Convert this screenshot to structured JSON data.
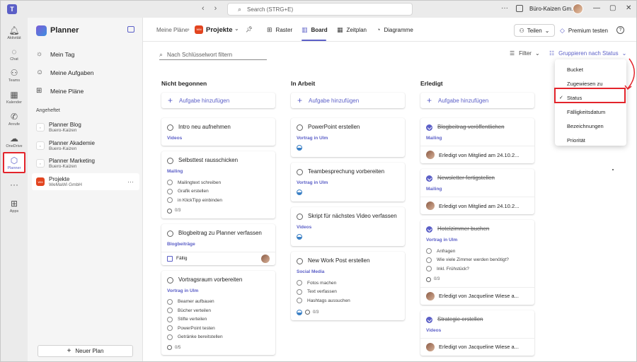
{
  "titlebar": {
    "search_placeholder": "Search (STRG+E)",
    "org_name": "Büro-Kaizen Gm..."
  },
  "rail": [
    {
      "label": "Aktivität",
      "icon": "bell-icon"
    },
    {
      "label": "Chat",
      "icon": "chat-icon"
    },
    {
      "label": "Teams",
      "icon": "teams-icon"
    },
    {
      "label": "Kalender",
      "icon": "calendar-icon"
    },
    {
      "label": "Anrufe",
      "icon": "phone-icon"
    },
    {
      "label": "OneDrive",
      "icon": "cloud-icon"
    },
    {
      "label": "Planner",
      "icon": "planner-icon"
    },
    {
      "label": "Apps",
      "icon": "apps-icon"
    }
  ],
  "sidebar": {
    "title": "Planner",
    "nav": [
      "Mein Tag",
      "Meine Aufgaben",
      "Meine Pläne"
    ],
    "pinned_heading": "Angeheftet",
    "plans": [
      {
        "name": "Planner Blog",
        "sub": "Buero-Kaizen"
      },
      {
        "name": "Planner Akademie",
        "sub": "Buero-Kaizen"
      },
      {
        "name": "Planner Marketing",
        "sub": "Buero-Kaizen"
      },
      {
        "name": "Projekte",
        "sub": "WeMaWi GmbH"
      }
    ],
    "new_plan": "Neuer Plan"
  },
  "header": {
    "breadcrumb": "Meine Pläne",
    "plan_name": "Projekte",
    "tabs": [
      "Raster",
      "Board",
      "Zeitplan",
      "Diagramme"
    ],
    "share": "Teilen",
    "premium": "Premium testen"
  },
  "filterbar": {
    "keyword_placeholder": "Nach Schlüsselwort filtern",
    "filter": "Filter",
    "group_by": "Gruppieren nach Status"
  },
  "add_task_label": "Aufgabe hinzufügen",
  "columns": [
    {
      "title": "Nicht begonnen",
      "cards": [
        {
          "title": "Intro neu aufnehmen",
          "label": "Videos"
        },
        {
          "title": "Selbsttest rausschicken",
          "label": "Mailing",
          "checklist": [
            "Mailingtext schreiben",
            "Grafik erstellen",
            "in KlickTipp einbinden"
          ],
          "count": "0/3"
        },
        {
          "title": "Blogbeitrag zu Planner verfassen",
          "label": "Blogbeiträge",
          "due": "Fällig"
        },
        {
          "title": "Vortragsraum vorbereiten",
          "label": "Vortrag in Ulm",
          "checklist": [
            "Beamer aufbauen",
            "Bücher verteilen",
            "Stifte verteilen",
            "PowerPoint testen",
            "Getränke bereitstellen"
          ],
          "count": "0/5"
        }
      ]
    },
    {
      "title": "In Arbeit",
      "cards": [
        {
          "title": "PowerPoint erstellen",
          "label": "Vortrag in Ulm"
        },
        {
          "title": "Teambesprechung vorbereiten",
          "label": "Vortrag in Ulm"
        },
        {
          "title": "Skript für nächstes Video verfassen",
          "label": "Videos"
        },
        {
          "title": "New Work Post erstellen",
          "label": "Social Media",
          "checklist": [
            "Fotos machen",
            "Text verfassen",
            "Hashtags aussuchen"
          ],
          "count": "0/3"
        }
      ]
    },
    {
      "title": "Erledigt",
      "cards": [
        {
          "title": "Blogbeitrag veröffentlichen",
          "label": "Mailing",
          "footer": "Erledigt von Mitglied am 24.10.2..."
        },
        {
          "title": "Newsletter fertigstellen",
          "label": "Mailing",
          "footer": "Erledigt von Mitglied am 24.10.2..."
        },
        {
          "title": "Hotelzimmer buchen",
          "label": "Vortrag in Ulm",
          "checklist": [
            "Anfragen",
            "Wie viele Zimmer werden benötigt?",
            "Inkl. Frühstück?"
          ],
          "count": "0/3",
          "footer": "Erledigt von Jacqueline Wiese a..."
        },
        {
          "title": "Strategie erstellen",
          "label": "Videos",
          "footer": "Erledigt von Jacqueline Wiese a..."
        }
      ]
    }
  ],
  "group_menu": [
    "Bucket",
    "Zugewiesen zu",
    "Status",
    "Fälligkeitsdatum",
    "Bezeichnungen",
    "Priorität"
  ],
  "colors": {
    "accent": "#5b5fc7",
    "highlight": "#e3242b",
    "plan_icon": "#e2441f"
  }
}
